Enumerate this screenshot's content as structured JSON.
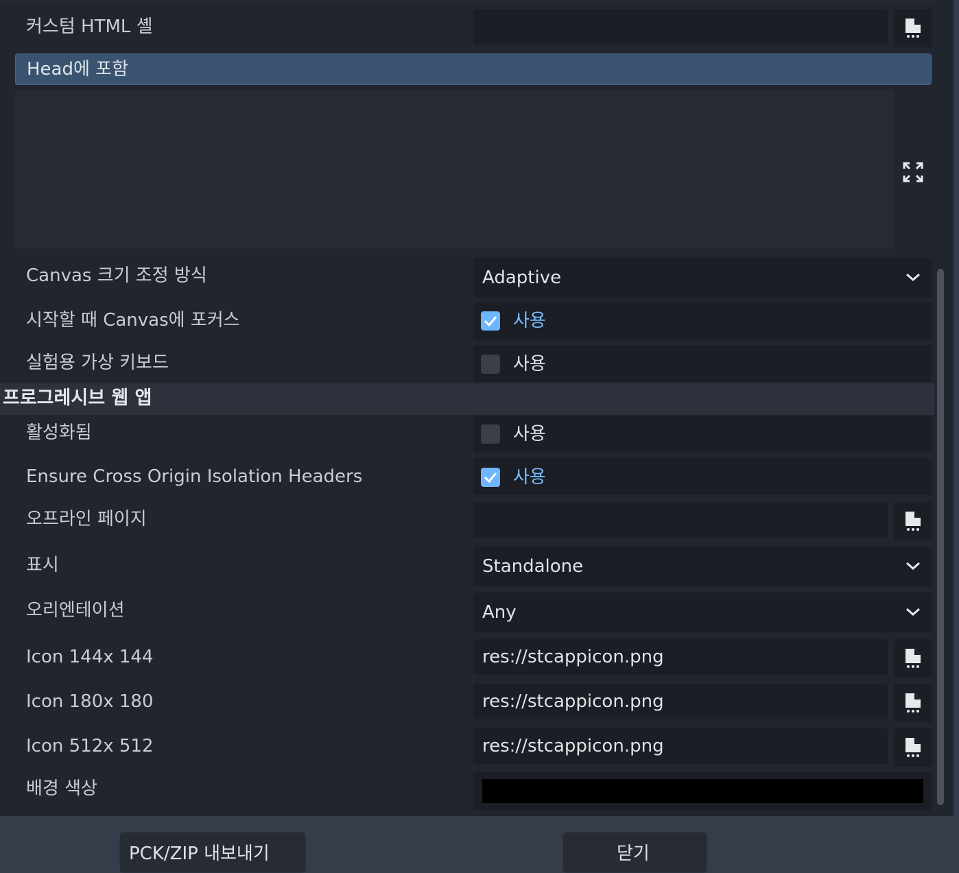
{
  "settings": {
    "custom_html_shell": {
      "label": "커스텀 HTML 셸",
      "value": ""
    },
    "head_include": {
      "label": "Head에 포함",
      "value": ""
    },
    "canvas_resize_policy": {
      "label": "Canvas 크기 조정 방식",
      "value": "Adaptive"
    },
    "focus_canvas_on_start": {
      "label": "시작할 때 Canvas에 포커스",
      "checked": true,
      "check_label": "사용"
    },
    "experimental_virtual_keyboard": {
      "label": "실험용 가상 키보드",
      "checked": false,
      "check_label": "사용"
    }
  },
  "pwa": {
    "section_title": "프로그레시브 웹 앱",
    "enabled": {
      "label": "활성화됨",
      "checked": false,
      "check_label": "사용"
    },
    "ensure_cross_origin": {
      "label": "Ensure Cross Origin Isolation Headers",
      "checked": true,
      "check_label": "사용"
    },
    "offline_page": {
      "label": "오프라인 페이지",
      "value": ""
    },
    "display": {
      "label": "표시",
      "value": "Standalone"
    },
    "orientation": {
      "label": "오리엔테이션",
      "value": "Any"
    },
    "icon_144": {
      "label": "Icon 144x 144",
      "value": "res://stcappicon.png"
    },
    "icon_180": {
      "label": "Icon 180x 180",
      "value": "res://stcappicon.png"
    },
    "icon_512": {
      "label": "Icon 512x 512",
      "value": "res://stcappicon.png"
    },
    "background_color": {
      "label": "배경 색상",
      "value": "#000000"
    }
  },
  "footer": {
    "export_pck_zip": "PCK/ZIP 내보내기",
    "close": "닫기"
  },
  "colors": {
    "panel": "#21252e",
    "accent": "#6eb6ff",
    "selection": "#3a5370"
  },
  "icons": [
    "file-icon",
    "expand-icon",
    "chevron-down-icon",
    "checkmark-icon"
  ]
}
